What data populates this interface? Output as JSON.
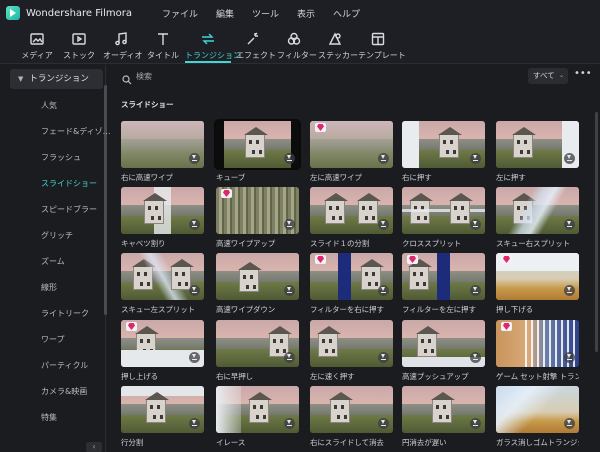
{
  "app": {
    "name": "Wondershare Filmora"
  },
  "menu": [
    "ファイル",
    "編集",
    "ツール",
    "表示",
    "ヘルプ"
  ],
  "toolbar": {
    "tabs": [
      {
        "label": "メディア",
        "icon": "media-icon"
      },
      {
        "label": "ストック",
        "icon": "stock-icon"
      },
      {
        "label": "オーディオ",
        "icon": "audio-icon"
      },
      {
        "label": "タイトル",
        "icon": "title-icon"
      },
      {
        "label": "トランジション",
        "icon": "transition-icon",
        "active": true
      },
      {
        "label": "エフェクト",
        "icon": "effect-icon"
      },
      {
        "label": "フィルター",
        "icon": "filter-icon"
      },
      {
        "label": "ステッカー",
        "icon": "sticker-icon"
      },
      {
        "label": "テンプレート",
        "icon": "template-icon"
      }
    ],
    "accent_color": "#43d5d0"
  },
  "sidebar": {
    "header": "トランジション",
    "items": [
      "人気",
      "フェード&ディゾ…",
      "フラッシュ",
      "スライドショー",
      "スピードブラー",
      "グリッチ",
      "ズーム",
      "線形",
      "ライトリーク",
      "ワープ",
      "パーティクル",
      "カメラ&映画",
      "特集"
    ],
    "active_item": "スライドショー"
  },
  "search": {
    "placeholder": "検索"
  },
  "filter": {
    "selected": "すべて"
  },
  "section": {
    "title": "スライドショー"
  },
  "transitions": [
    {
      "label": "右に高速ワイプ",
      "premium": false
    },
    {
      "label": "キューブ",
      "premium": false,
      "selected": true
    },
    {
      "label": "左に高速ワイプ",
      "premium": true
    },
    {
      "label": "右に押す",
      "premium": false
    },
    {
      "label": "左に押す",
      "premium": false
    },
    {
      "label": "キャベツ割り",
      "premium": false
    },
    {
      "label": "高速ワイプアップ",
      "premium": true
    },
    {
      "label": "スライド１の分割",
      "premium": false
    },
    {
      "label": "クロススプリット",
      "premium": false
    },
    {
      "label": "スキュー右スプリット",
      "premium": false
    },
    {
      "label": "スキュー左スプリット",
      "premium": false
    },
    {
      "label": "高速ワイプダウン",
      "premium": false
    },
    {
      "label": "フィルターを右に押す",
      "premium": true
    },
    {
      "label": "フィルターを左に押す",
      "premium": true
    },
    {
      "label": "押し下げる",
      "premium": true
    },
    {
      "label": "押し上げる",
      "premium": true
    },
    {
      "label": "右に早押し",
      "premium": false
    },
    {
      "label": "左に速く押す",
      "premium": false
    },
    {
      "label": "高速プッシュアップ",
      "premium": false
    },
    {
      "label": "ゲーム セット射撃 トランジ…",
      "premium": true
    },
    {
      "label": "行分割",
      "premium": false
    },
    {
      "label": "イレース",
      "premium": false
    },
    {
      "label": "右にスライドして消去",
      "premium": false
    },
    {
      "label": "円消去が遅い",
      "premium": false
    },
    {
      "label": "ガラス消しゴムトランジション",
      "premium": false
    }
  ]
}
